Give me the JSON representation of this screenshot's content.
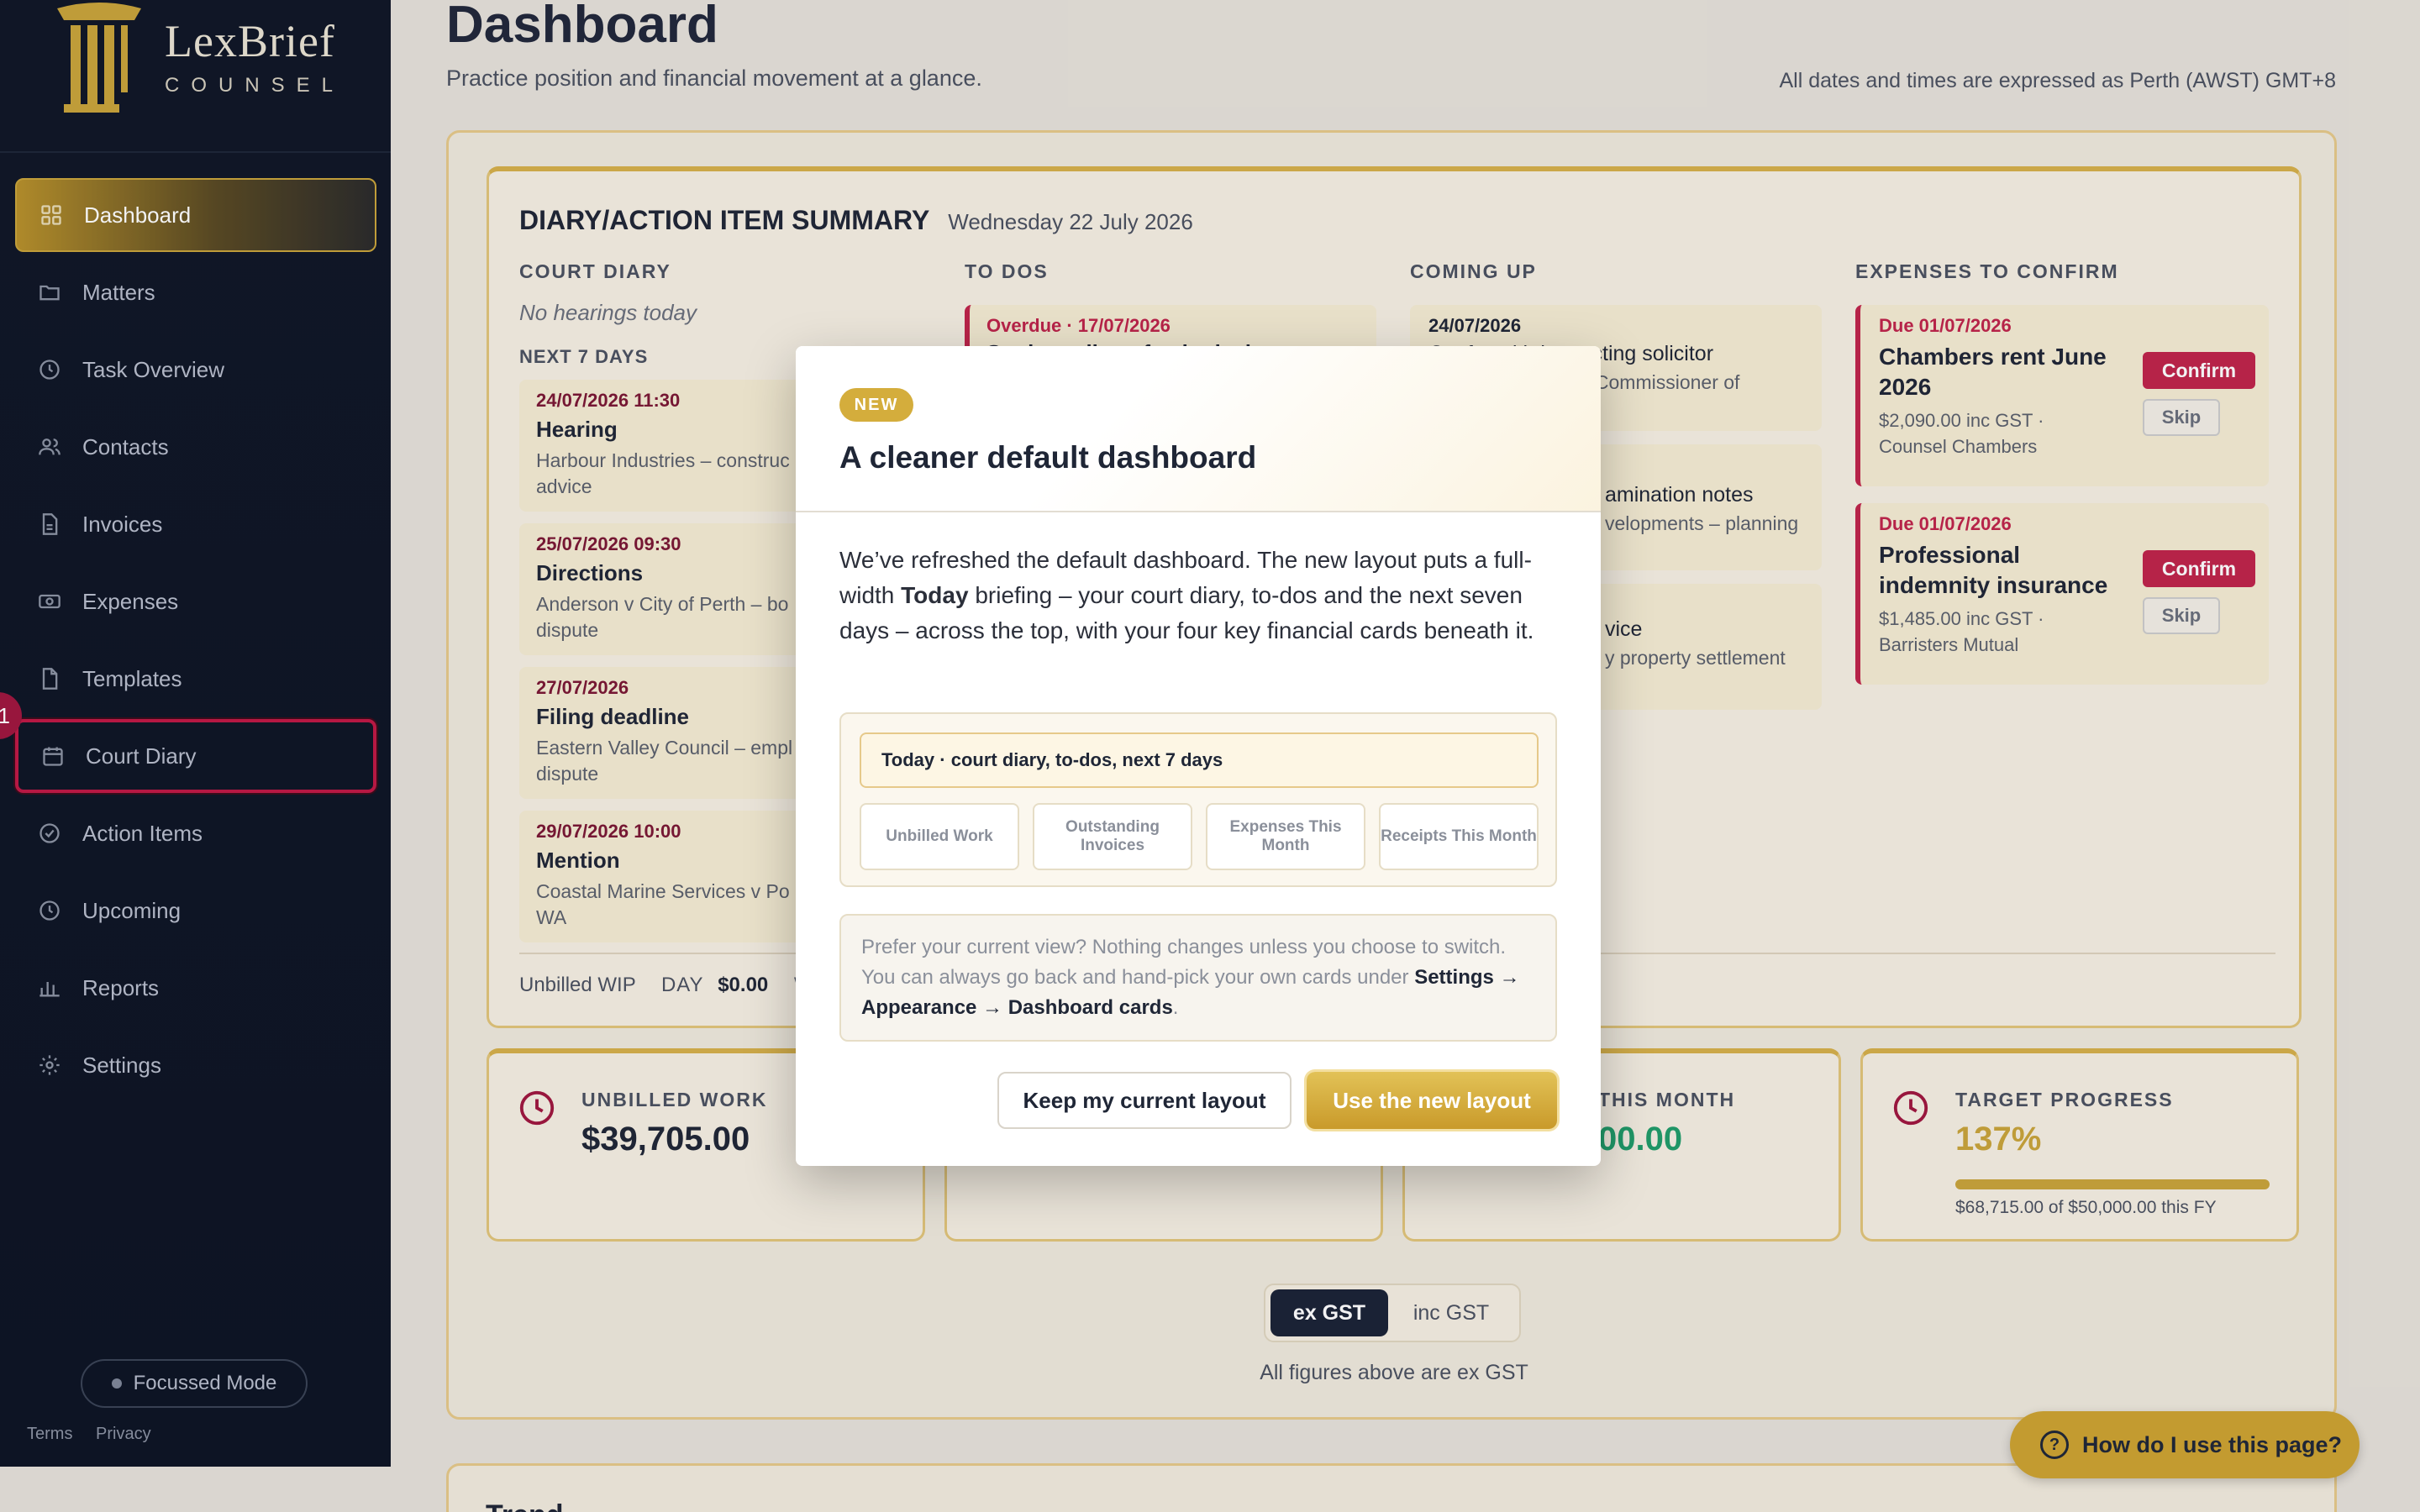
{
  "sidebar": {
    "brand_top": "LexBrief",
    "brand_bottom": "COUNSEL",
    "items": [
      {
        "label": "Dashboard",
        "icon": "grid-icon"
      },
      {
        "label": "Matters",
        "icon": "folder-icon"
      },
      {
        "label": "Task Overview",
        "icon": "clock-icon"
      },
      {
        "label": "Contacts",
        "icon": "users-icon"
      },
      {
        "label": "Invoices",
        "icon": "document-icon"
      },
      {
        "label": "Expenses",
        "icon": "banknote-icon"
      },
      {
        "label": "Templates",
        "icon": "file-icon"
      },
      {
        "label": "Court Diary",
        "icon": "calendar-icon"
      },
      {
        "label": "Action Items",
        "icon": "check-circle-icon"
      },
      {
        "label": "Upcoming",
        "icon": "clock-icon"
      },
      {
        "label": "Reports",
        "icon": "bar-chart-icon"
      },
      {
        "label": "Settings",
        "icon": "gear-icon"
      }
    ],
    "highlight_badge": "1",
    "focussed_mode": "Focussed Mode",
    "footer": {
      "terms": "Terms",
      "privacy": "Privacy"
    }
  },
  "header": {
    "title": "Dashboard",
    "subtitle": "Practice position and financial movement at a glance.",
    "timezone_note": "All dates and times are expressed as Perth (AWST) GMT+8"
  },
  "diary": {
    "title": "DIARY/ACTION ITEM SUMMARY",
    "date": "Wednesday 22 July 2026",
    "court_diary": {
      "heading": "COURT DIARY",
      "empty": "No hearings today",
      "next7": "NEXT 7 DAYS",
      "events": [
        {
          "datetime": "24/07/2026 11:30",
          "title": "Hearing",
          "desc": "Harbour Industries – construc advice"
        },
        {
          "datetime": "25/07/2026 09:30",
          "title": "Directions",
          "desc": "Anderson v City of Perth – bo dispute"
        },
        {
          "datetime": "27/07/2026",
          "title": "Filing deadline",
          "desc": "Eastern Valley Council – empl dispute"
        },
        {
          "datetime": "29/07/2026 10:00",
          "title": "Mention",
          "desc": "Coastal Marine Services v Po WA"
        }
      ]
    },
    "todos": {
      "heading": "TO DOS",
      "items": [
        {
          "overdue": "Overdue · 17/07/2026",
          "title": "Settle outline of submissions"
        }
      ]
    },
    "coming_up": {
      "heading": "COMING UP",
      "items": [
        {
          "date": "24/07/2026",
          "title": "Confer with instructing solicitor",
          "desc": "v Commissioner of"
        },
        {
          "date": "",
          "title": "amination notes",
          "desc": "velopments – planning"
        },
        {
          "date": "",
          "title": "vice",
          "desc": "y property settlement"
        }
      ]
    },
    "expenses": {
      "heading": "EXPENSES TO CONFIRM",
      "confirm_label": "Confirm",
      "skip_label": "Skip",
      "items": [
        {
          "due": "Due 01/07/2026",
          "title": "Chambers rent June 2026",
          "amount": "$2,090.00 inc GST · Counsel Chambers"
        },
        {
          "due": "Due 01/07/2026",
          "title": "Professional indemnity insurance",
          "amount": "$1,485.00 inc GST · Barristers Mutual"
        }
      ]
    },
    "wip": {
      "label": "Unbilled WIP",
      "day_label": "DAY",
      "day_value": "$0.00",
      "next_label": "W"
    }
  },
  "cards": [
    {
      "label": "UNBILLED WORK",
      "value": "$39,705.00",
      "icon": "clock-icon"
    },
    {
      "label": "",
      "value": "",
      "icon": ""
    },
    {
      "label": "THIS MONTH",
      "value": "00.00",
      "icon": ""
    },
    {
      "label": "TARGET PROGRESS",
      "value": "137%",
      "icon": "clock-icon",
      "progress": 1.0,
      "caption": "$68,715.00 of $50,000.00 this FY"
    }
  ],
  "gst_toggle": {
    "ex": "ex GST",
    "inc": "inc GST",
    "selected": "ex GST",
    "note": "All figures above are ex GST"
  },
  "trend_title": "Trend",
  "help_button": "How do I use this page?",
  "modal": {
    "badge": "NEW",
    "title": "A cleaner default dashboard",
    "body_pre": "We’ve refreshed the default dashboard. The new layout puts a full-width ",
    "body_bold": "Today",
    "body_post": " briefing – your court diary, to-dos and the next seven days – across the top, with your four key financial cards beneath it.",
    "preview_today": "Today · court diary, to-dos, next 7 days",
    "preview_cards": [
      "Unbilled Work",
      "Outstanding Invoices",
      "Expenses This Month",
      "Receipts This Month"
    ],
    "note_pre": "Prefer your current view? Nothing changes unless you choose to switch. You can always go back and hand-pick your own cards under ",
    "note_bold": "Settings → Appearance → Dashboard cards",
    "note_post": ".",
    "keep_label": "Keep my current layout",
    "use_label": "Use the new layout"
  },
  "colors": {
    "accent_gold": "#c9a43a",
    "danger": "#c0244a",
    "navy": "#0f1626",
    "green": "#1f9d6a"
  }
}
